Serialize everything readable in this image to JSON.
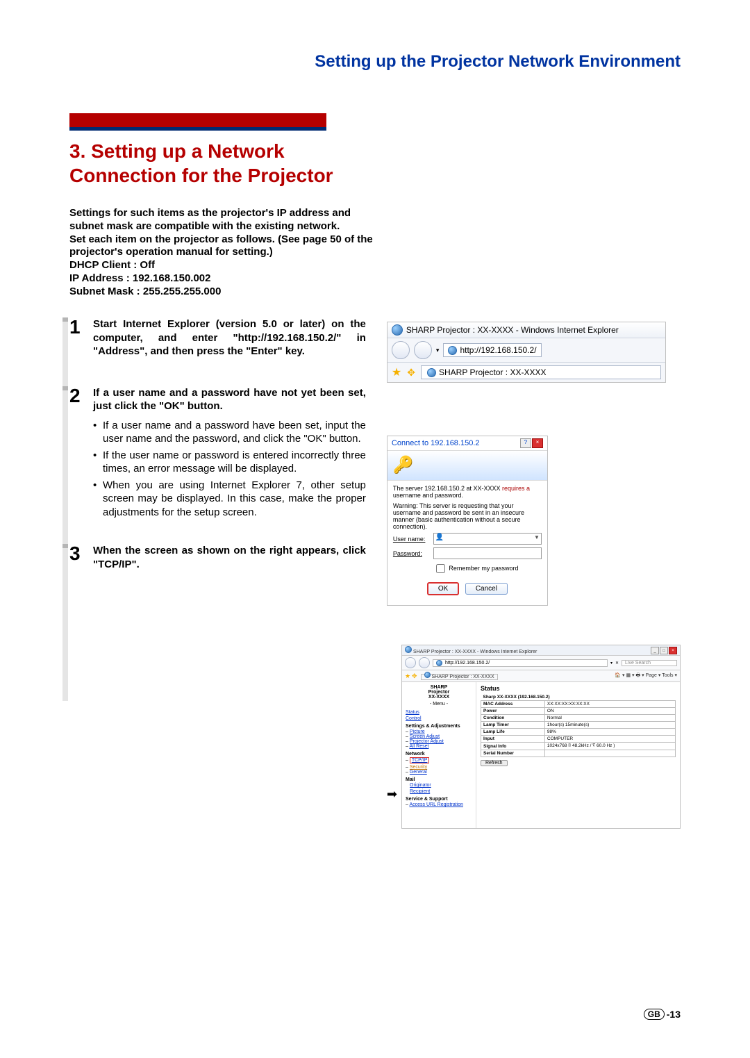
{
  "header_title": "Setting up the Projector Network Environment",
  "section_title": "3. Setting up a Network Connection for the Projector",
  "intro": "Settings for such items as the projector's IP address and subnet mask are compatible with the existing network.\nSet each item on the projector as follows. (See page 50 of the projector's operation manual for setting.)\nDHCP Client : Off\nIP Address : 192.168.150.002\nSubnet Mask : 255.255.255.000",
  "steps": {
    "s1": {
      "num": "1",
      "heading": "Start Internet Explorer (version 5.0 or later) on the computer, and enter \"http://192.168.150.2/\" in \"Address\", and then press the \"Enter\" key."
    },
    "s2": {
      "num": "2",
      "heading": "If a user name and a password have not yet been set, just click the \"OK\" button.",
      "b1": "If a user name and a password have been set, input the user name and the password, and click the \"OK\" button.",
      "b2": "If the user name or password is entered incorrectly three times, an error message will be displayed.",
      "b3": "When you are using Internet Explorer 7, other setup screen may be displayed. In this case, make the proper adjustments for the setup screen."
    },
    "s3": {
      "num": "3",
      "heading": "When the screen as shown on the right appears, click \"TCP/IP\"."
    }
  },
  "shot1": {
    "title": "SHARP Projector : XX-XXXX - Windows Internet Explorer",
    "url": "http://192.168.150.2/",
    "tab": "SHARP Projector : XX-XXXX"
  },
  "shot2": {
    "title": "Connect to 192.168.150.2",
    "msg1_a": "The server 192.168.150.2 at XX-XXXX",
    "msg1_b": "requires a",
    "msg1_c": "username and password.",
    "msg2": "Warning: This server is requesting that your username and password be sent in an insecure manner (basic authentication without a secure connection).",
    "user": "User name:",
    "pass": "Password:",
    "remember": "Remember my password",
    "ok": "OK",
    "cancel": "Cancel"
  },
  "shot3": {
    "title": "SHARP Projector : XX-XXXX - Windows Internet Explorer",
    "url": "http://192.168.150.2/",
    "search": "Live Search",
    "tab": "SHARP Projector : XX-XXXX",
    "toolbar_right": "Page ▾   Tools ▾",
    "nav_brand1": "SHARP",
    "nav_brand2": "Projector",
    "nav_brand3": "XX-XXXX",
    "nav_menu": "- Menu -",
    "nav": {
      "status": "Status",
      "control": "Control",
      "sa": "Settings & Adjustments",
      "picture": "Picture",
      "scr": "Screen Adjust",
      "pj": "Projector Adjust",
      "all": "All Reset",
      "net": "Network",
      "tcpip": "TCP/IP",
      "sec": "Security",
      "gen": "General",
      "mail": "Mail",
      "orig": "Originator",
      "recip": "Recipient",
      "ss": "Service & Support",
      "acc": "Access URL Registration"
    },
    "content_title": "Status",
    "tbl_caption": "Sharp XX-XXXX (192.168.150.2)",
    "rows": {
      "mac": {
        "l": "MAC Address",
        "v": "XX:XX:XX:XX:XX:XX"
      },
      "pwr": {
        "l": "Power",
        "v": "ON"
      },
      "cond": {
        "l": "Condition",
        "v": "Normal"
      },
      "lt": {
        "l": "Lamp Timer",
        "v": "1hour(s) 15minute(s)"
      },
      "ll": {
        "l": "Lamp Life",
        "v": "98%"
      },
      "in": {
        "l": "Input",
        "v": "COMPUTER"
      },
      "sig": {
        "l": "Signal Info",
        "v": "1024x768 ⌷ 48.2kHz / ∇ 60.0 Hz )"
      },
      "sn": {
        "l": "Serial Number",
        "v": ""
      }
    },
    "refresh": "Refresh"
  },
  "footer": {
    "gb": "GB",
    "page": "-13"
  }
}
